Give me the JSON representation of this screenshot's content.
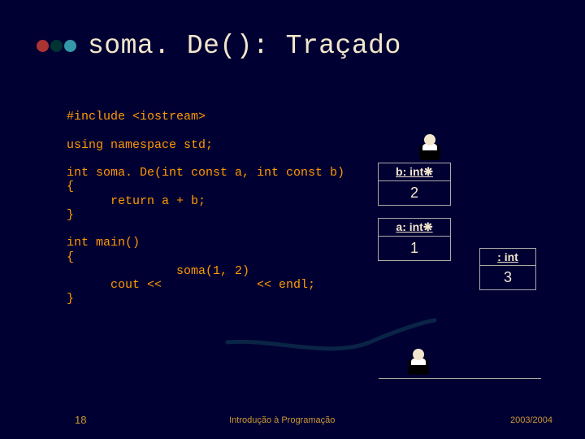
{
  "title": "soma. De(): Traçado",
  "code": {
    "l1": "#include <iostream>",
    "l2": "",
    "l3": "using namespace std;",
    "l4": "",
    "l5": "int soma. De(int const a, int const b)",
    "l6": "{",
    "l7": "      return a + b;",
    "l8": "}",
    "l9": "",
    "l10": "int main()",
    "l11": "{",
    "l12": "               soma(1, 2)",
    "l13": "      cout <<             << endl;",
    "l14": "}"
  },
  "diagram": {
    "b_label": "b: int❋",
    "b_value": "2",
    "a_label": "a: int❋",
    "a_value": "1",
    "r_label": ": int",
    "r_value": "3"
  },
  "footer": {
    "page": "18",
    "title": "Introdução à Programação",
    "year": "2003/2004"
  }
}
